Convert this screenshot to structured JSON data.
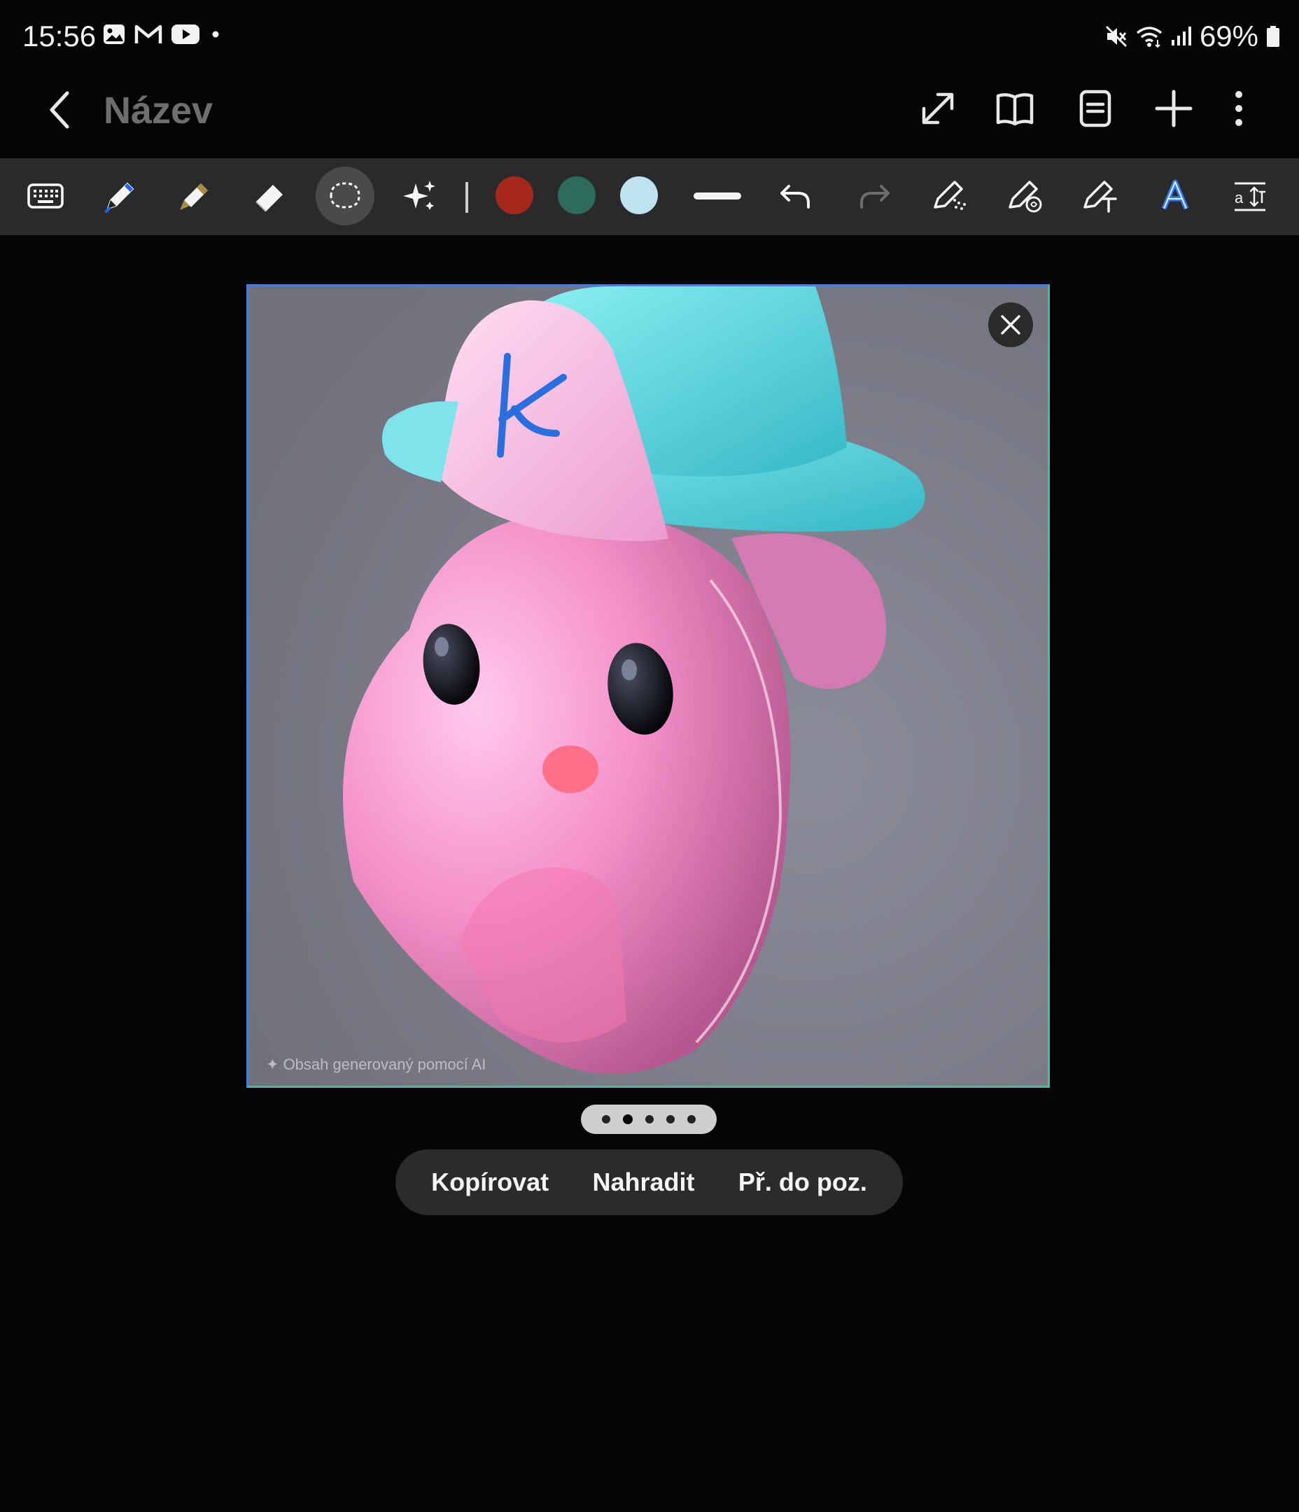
{
  "status_bar": {
    "time": "15:56",
    "notification_icons": [
      "gallery-icon",
      "gmail-icon",
      "youtube-icon",
      "dot-icon"
    ],
    "system_icons": [
      "mute-icon",
      "wifi-icon",
      "signal-icon",
      "battery-icon"
    ],
    "battery_percent": "69%"
  },
  "app_bar": {
    "title": "Název",
    "actions": [
      "expand-icon",
      "book-icon",
      "note-icon",
      "add-icon",
      "more-icon"
    ]
  },
  "toolbar": {
    "tools": [
      "keyboard-icon",
      "pen-icon",
      "highlighter-icon",
      "eraser-icon",
      "lasso-icon",
      "ai-assist-icon"
    ],
    "active_tool": "lasso-icon",
    "colors": [
      "#a5281b",
      "#2e6b5c",
      "#bfe3ee"
    ],
    "extra_tools": [
      "stroke-width-icon",
      "undo-icon",
      "redo-icon",
      "shape-recognize-icon",
      "drawing-assist-icon",
      "text-convert-icon",
      "font-icon",
      "text-format-icon"
    ]
  },
  "image": {
    "ai_label": "Obsah generovaný pomocí AI",
    "cap_letter": "K",
    "pages": 5,
    "current_page": 2
  },
  "context_menu": {
    "copy": "Kopírovat",
    "replace": "Nahradit",
    "set_background": "Př. do poz."
  }
}
